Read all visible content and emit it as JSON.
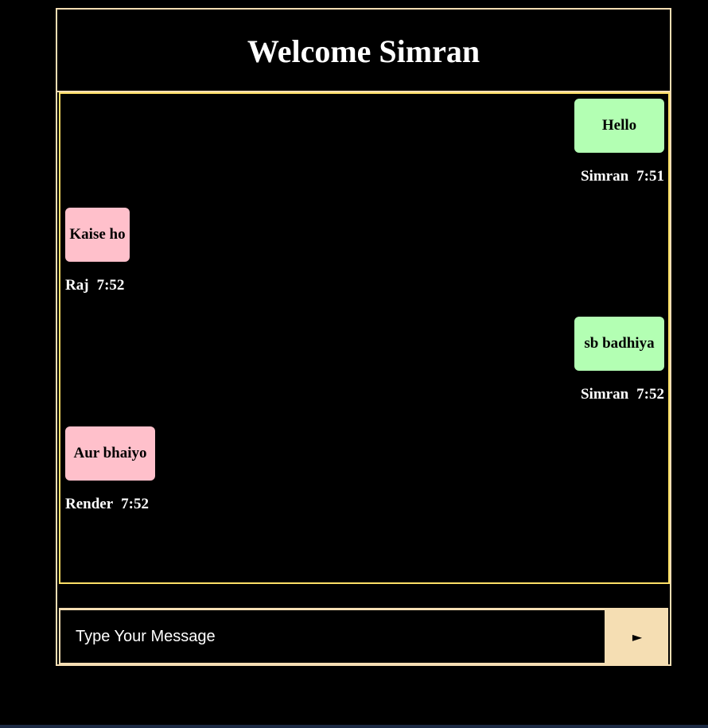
{
  "header": {
    "title": "Welcome Simran"
  },
  "messages": [
    {
      "text": "Hello",
      "sender": "Simran",
      "time": "7:51",
      "side": "right",
      "bubble_color": "#b3ffb3"
    },
    {
      "text": "Kaise ho",
      "sender": "Raj",
      "time": "7:52",
      "side": "left",
      "bubble_color": "#ffc0cb"
    },
    {
      "text": "sb badhiya",
      "sender": "Simran",
      "time": "7:52",
      "side": "right",
      "bubble_color": "#b3ffb3"
    },
    {
      "text": "Aur bhaiyo",
      "sender": "Render",
      "time": "7:52",
      "side": "left",
      "bubble_color": "#ffc0cb"
    }
  ],
  "composer": {
    "placeholder": "Type Your Message",
    "value": "",
    "send_icon": "►",
    "send_icon_name": "send-arrow-icon"
  },
  "colors": {
    "frame": "#f5deb3",
    "messages_border": "#ffe066",
    "background": "#000000"
  }
}
